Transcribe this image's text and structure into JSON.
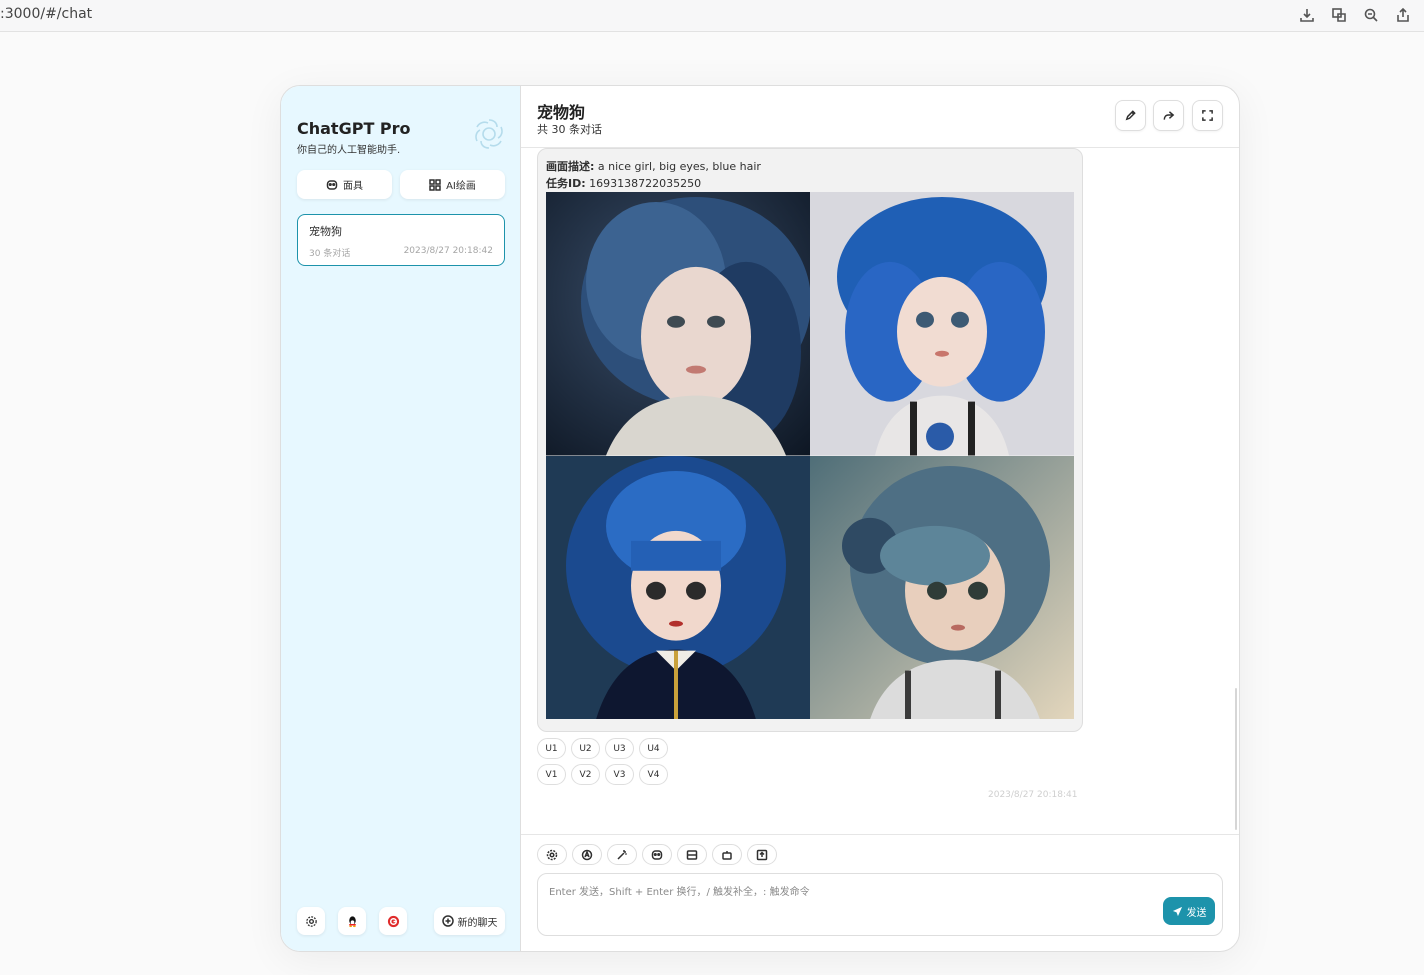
{
  "browser": {
    "url": ":3000/#/chat",
    "tools": [
      "download-icon",
      "translate-icon",
      "zoom-icon",
      "share-icon"
    ]
  },
  "sidebar": {
    "title": "ChatGPT Pro",
    "subtitle": "你自己的人工智能助手.",
    "mask_button": "面具",
    "draw_button": "AI绘画",
    "chats": [
      {
        "title": "宠物狗",
        "count": "30 条对话",
        "time": "2023/8/27 20:18:42"
      }
    ],
    "new_chat_button": "新的聊天",
    "accent": "#1d93ab",
    "background": "#e7f8ff"
  },
  "header": {
    "title": "宠物狗",
    "subtitle": "共 30 条对话"
  },
  "message": {
    "desc_label": "画面描述:",
    "desc_value": "a nice girl, big eyes, blue hair",
    "task_label": "任务ID:",
    "task_value": "1693138722035250",
    "upscale_buttons": [
      "U1",
      "U2",
      "U3",
      "U4"
    ],
    "variation_buttons": [
      "V1",
      "V2",
      "V3",
      "V4"
    ],
    "date": "2023/8/27 20:18:41"
  },
  "input": {
    "placeholder": "Enter 发送，Shift + Enter 换行，/ 触发补全，: 触发命令",
    "send_label": "发送",
    "tools": [
      "settings-icon",
      "theme-icon",
      "prompt-icon",
      "mask-icon",
      "clear-icon",
      "robot-icon",
      "upload-icon"
    ]
  }
}
